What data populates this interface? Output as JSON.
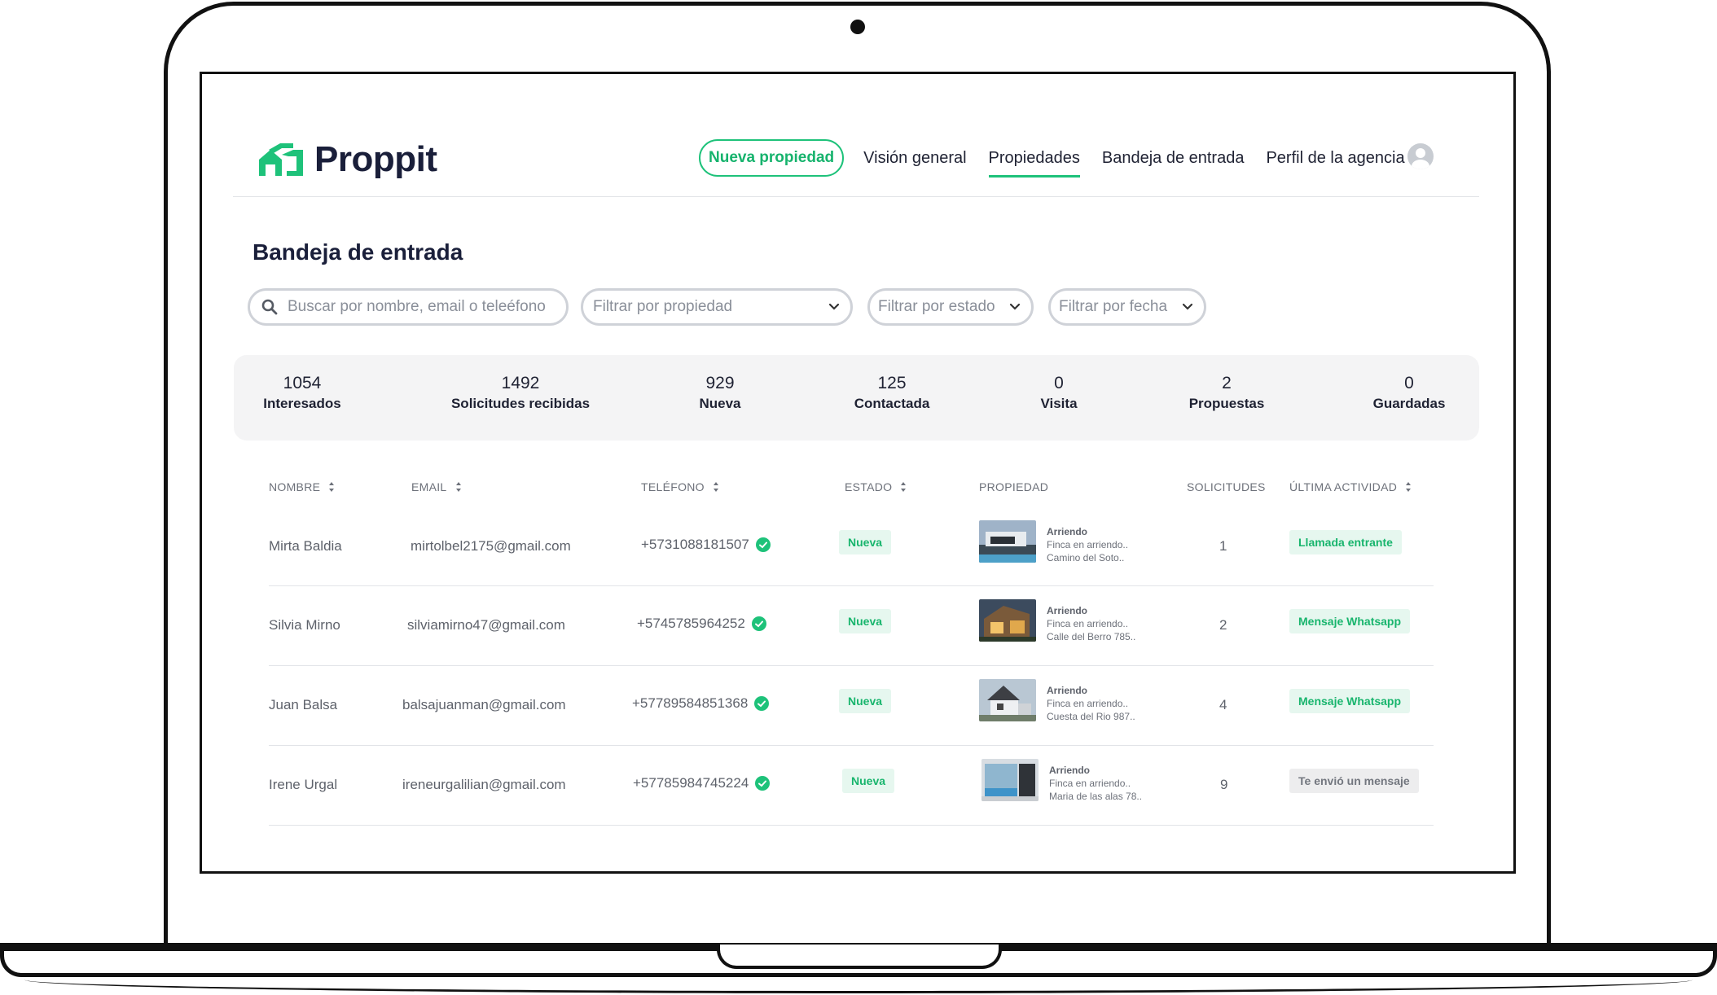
{
  "brand": {
    "name": "Proppit",
    "accent": "#1ec27a"
  },
  "nav": {
    "new_property": "Nueva propiedad",
    "links": [
      "Visión general",
      "Propiedades",
      "Bandeja de entrada",
      "Perfil de la agencia"
    ],
    "active": "Propiedades"
  },
  "page_title": "Bandeja de entrada",
  "filters": {
    "search_placeholder": "Buscar por nombre, email o teleéfono",
    "property": "Filtrar por propiedad",
    "status": "Filtrar por estado",
    "date": "Filtrar por fecha"
  },
  "stats": [
    {
      "value": "1054",
      "label": "Interesados"
    },
    {
      "value": "1492",
      "label": "Solicitudes recibidas"
    },
    {
      "value": "929",
      "label": "Nueva"
    },
    {
      "value": "125",
      "label": "Contactada"
    },
    {
      "value": "0",
      "label": "Visita"
    },
    {
      "value": "2",
      "label": "Propuestas"
    },
    {
      "value": "0",
      "label": "Guardadas"
    }
  ],
  "table": {
    "headers": [
      "NOMBRE",
      "EMAIL",
      "TELÉFONO",
      "ESTADO",
      "PROPIEDAD",
      "SOLICITUDES",
      "ÚLTIMA ACTIVIDAD"
    ],
    "rows": [
      {
        "name": "Mirta Baldia",
        "email": "mirtolbel2175@gmail.com",
        "phone": "+5731088181507",
        "status": "Nueva",
        "property": {
          "type": "Arriendo",
          "title": "Finca en arriendo..",
          "address": "Camino del Soto.."
        },
        "requests": "1",
        "activity": "Llamada entrante",
        "activity_style": "green",
        "thumb": "modern-house-pool"
      },
      {
        "name": "Silvia Mirno",
        "email": "silviamirno47@gmail.com",
        "phone": "+5745785964252",
        "status": "Nueva",
        "property": {
          "type": "Arriendo",
          "title": "Finca en arriendo..",
          "address": "Calle del Berro 785.."
        },
        "requests": "2",
        "activity": "Mensaje Whatsapp",
        "activity_style": "green",
        "thumb": "wood-house-dusk"
      },
      {
        "name": "Juan Balsa",
        "email": "balsajuanman@gmail.com",
        "phone": "+57789584851368",
        "status": "Nueva",
        "property": {
          "type": "Arriendo",
          "title": "Finca en arriendo..",
          "address": "Cuesta del Rio 987.."
        },
        "requests": "4",
        "activity": "Mensaje Whatsapp",
        "activity_style": "green",
        "thumb": "gabled-house"
      },
      {
        "name": "Irene Urgal",
        "email": "ireneurgalilian@gmail.com",
        "phone": "+57785984745224",
        "status": "Nueva",
        "property": {
          "type": "Arriendo",
          "title": "Finca en arriendo..",
          "address": "Maria de las alas 78.."
        },
        "requests": "9",
        "activity": "Te envió un mensaje",
        "activity_style": "grey",
        "thumb": "interior-pool-view"
      }
    ]
  }
}
